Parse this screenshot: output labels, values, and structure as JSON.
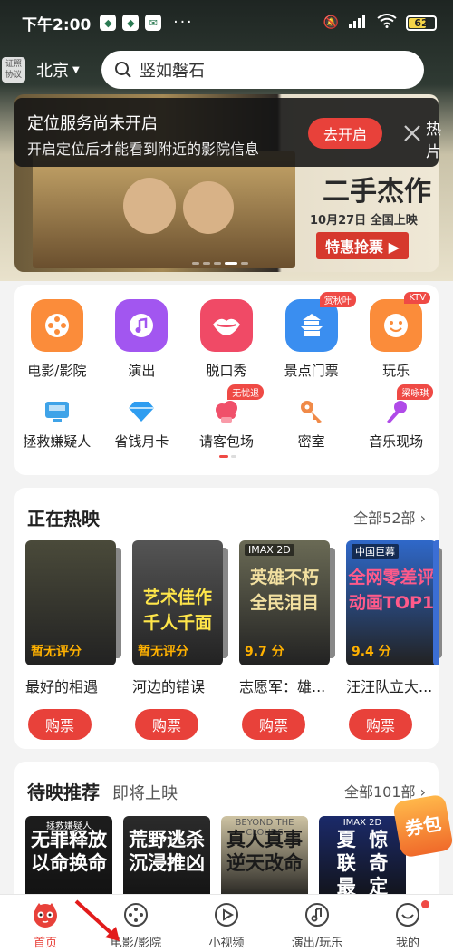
{
  "status_bar": {
    "time": "下午2:00",
    "dots": "···",
    "net": "HD",
    "battery": "62"
  },
  "header": {
    "license": "证照协议",
    "city": "北京",
    "search_placeholder": "竖如磐石"
  },
  "banner": {
    "title": "二手杰作",
    "date": "10月27日 全国上映",
    "promo": "特惠抢票 ▶"
  },
  "location_toast": {
    "title": "定位服务尚未开启",
    "subtitle": "开启定位后才能看到附近的影院信息",
    "open_label": "去开启",
    "edge_text": "热片"
  },
  "categories": [
    {
      "label": "电影/影院",
      "icon": "film-reel-icon",
      "color": "#fb8c3a",
      "tag": ""
    },
    {
      "label": "演出",
      "icon": "music-note-icon",
      "color": "#a256f0",
      "tag": ""
    },
    {
      "label": "脱口秀",
      "icon": "lips-icon",
      "color": "#f04a66",
      "tag": ""
    },
    {
      "label": "景点门票",
      "icon": "temple-icon",
      "color": "#3a8ef0",
      "tag": "赏秋叶"
    },
    {
      "label": "玩乐",
      "icon": "smiley-icon",
      "color": "#fb8c3a",
      "tag": "KTV"
    }
  ],
  "categories_row2": [
    {
      "label": "拯救嫌疑人",
      "icon": "tv-icon",
      "tag": ""
    },
    {
      "label": "省钱月卡",
      "icon": "diamond-icon",
      "tag": ""
    },
    {
      "label": "请客包场",
      "icon": "cloud-icon",
      "tag": "无忧退"
    },
    {
      "label": "密室",
      "icon": "key-icon",
      "tag": ""
    },
    {
      "label": "音乐现场",
      "icon": "microphone-icon",
      "tag": "梁咏琪"
    }
  ],
  "now_showing": {
    "title": "正在热映",
    "more": "全部52部 ›",
    "movies": [
      {
        "name": "最好的相遇",
        "score": "暂无评分",
        "poster_text": "",
        "badge": "",
        "bg": "#4a4a3a",
        "buy": "购票"
      },
      {
        "name": "河边的错误",
        "score": "暂无评分",
        "poster_text": "艺术佳作\n千人千面",
        "badge": "",
        "bg": "#555",
        "buy": "购票"
      },
      {
        "name": "志愿军：雄...",
        "score": "9.7 分",
        "poster_text": "英雄不朽\n全民泪目",
        "badge": "IMAX 2D",
        "bg": "#6a6a55",
        "buy": "购票"
      },
      {
        "name": "汪汪队立大...",
        "score": "9.4 分",
        "poster_text": "全网零差评\n动画TOP1",
        "badge": "中国巨幕",
        "bg": "#2f68c9",
        "buy": "购票"
      }
    ]
  },
  "upcoming": {
    "tab_active": "待映推荐",
    "tab_inactive": "即将上映",
    "more": "全部101部 ›",
    "posters": [
      {
        "top": "拯救嫌疑人",
        "text": "无罪释放\n以命换命",
        "bg": "#1d1d1d"
      },
      {
        "top": "",
        "text": "荒野逃杀\n沉浸推凶",
        "bg": "#2b2b2b"
      },
      {
        "top": "BEYOND THE CLOUDS",
        "text": "真人真事\n逆天改命",
        "bg": "#cfc4a4"
      },
      {
        "top": "IMAX 2D",
        "text": "夏  惊\n联  奇\n最  定",
        "bg": "#1b2a6a"
      }
    ],
    "redeem_label": "券包"
  },
  "bottom_nav": [
    {
      "label": "首页",
      "icon": "cat-home-icon",
      "active": true
    },
    {
      "label": "电影/影院",
      "icon": "film-reel-icon",
      "active": false
    },
    {
      "label": "小视频",
      "icon": "play-icon",
      "active": false
    },
    {
      "label": "演出/玩乐",
      "icon": "music-note-icon",
      "active": false
    },
    {
      "label": "我的",
      "icon": "smiley-icon",
      "active": false
    }
  ],
  "colors": {
    "accent": "#e8413a",
    "page_bg": "#f3f3f3"
  }
}
